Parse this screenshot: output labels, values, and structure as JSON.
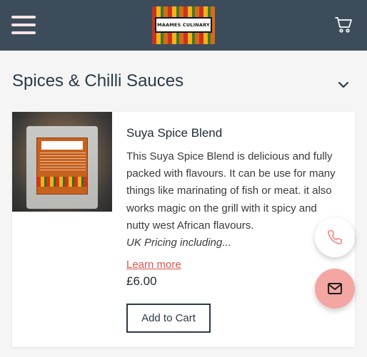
{
  "header": {
    "logo_text": "MAAMES CULINARY",
    "menu_icon": "hamburger-menu-icon",
    "cart_icon": "shopping-cart-icon"
  },
  "section": {
    "title": "Spices & Chilli Sauces",
    "toggle_icon": "chevron-down-icon"
  },
  "product": {
    "name": "Suya Spice Blend",
    "description": "This Suya Spice Blend is delicious and fully packed with flavours. It can be use for many things like marinating of fish or meat. it also works magic on the grill with it spicy and nutty west African flavours.",
    "pricing_note": "UK Pricing including...",
    "learn_more": "Learn more",
    "price": "£6.00",
    "add_to_cart": "Add to Cart"
  },
  "fabs": {
    "call_icon": "phone-icon",
    "mail_icon": "mail-icon"
  },
  "colors": {
    "header_bg": "#3c4c5b",
    "accent": "#d9534f",
    "fab_mail_bg": "#f3a6a2"
  }
}
